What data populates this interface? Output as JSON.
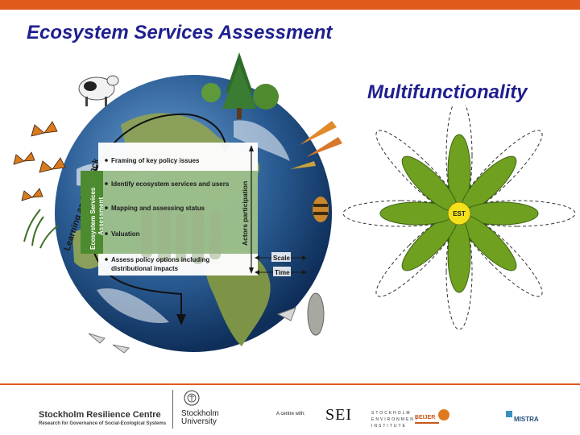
{
  "header": {
    "title": "Ecosystem Services Assessment",
    "colors": {
      "accent": "#e05a1e",
      "title": "#1f1f8f"
    }
  },
  "diagram": {
    "loop_label": "Learning and feedback",
    "band_label_1": "Ecosystem Services",
    "band_label_2": "Assessment",
    "actors_label": "Actors participation",
    "steps": [
      "Framing of key policy issues",
      "Identify ecosystem services and users",
      "Mapping and assessing status",
      "Valuation",
      "Assess policy options including",
      "distributional impacts"
    ],
    "scale_label": "Scale",
    "time_label": "Time",
    "colors": {
      "band": "#4c8b2f",
      "ocean": "#2a5c93",
      "panel": "#ffffff"
    }
  },
  "multifunctionality": {
    "title": "Multifunctionality",
    "center_label": "EST",
    "colors": {
      "petal": "#6fa020",
      "petal_edge": "#3d6410",
      "center": "#f2e11b"
    }
  },
  "footer": {
    "src_name": "Stockholm Resilience Centre",
    "src_subtitle": "Research for Governance of Social-Ecological Systems",
    "university_line1": "Stockholm",
    "university_line2": "University",
    "centre_with": "A centre with:",
    "sei_mark": "SEI",
    "sei_name_line1": "STOCKHOLM",
    "sei_name_line2": "ENVIRONMENT",
    "sei_name_line3": "INSTITUTE",
    "beijer_name": "BEIJER",
    "mistra_name": "MISTRA"
  }
}
